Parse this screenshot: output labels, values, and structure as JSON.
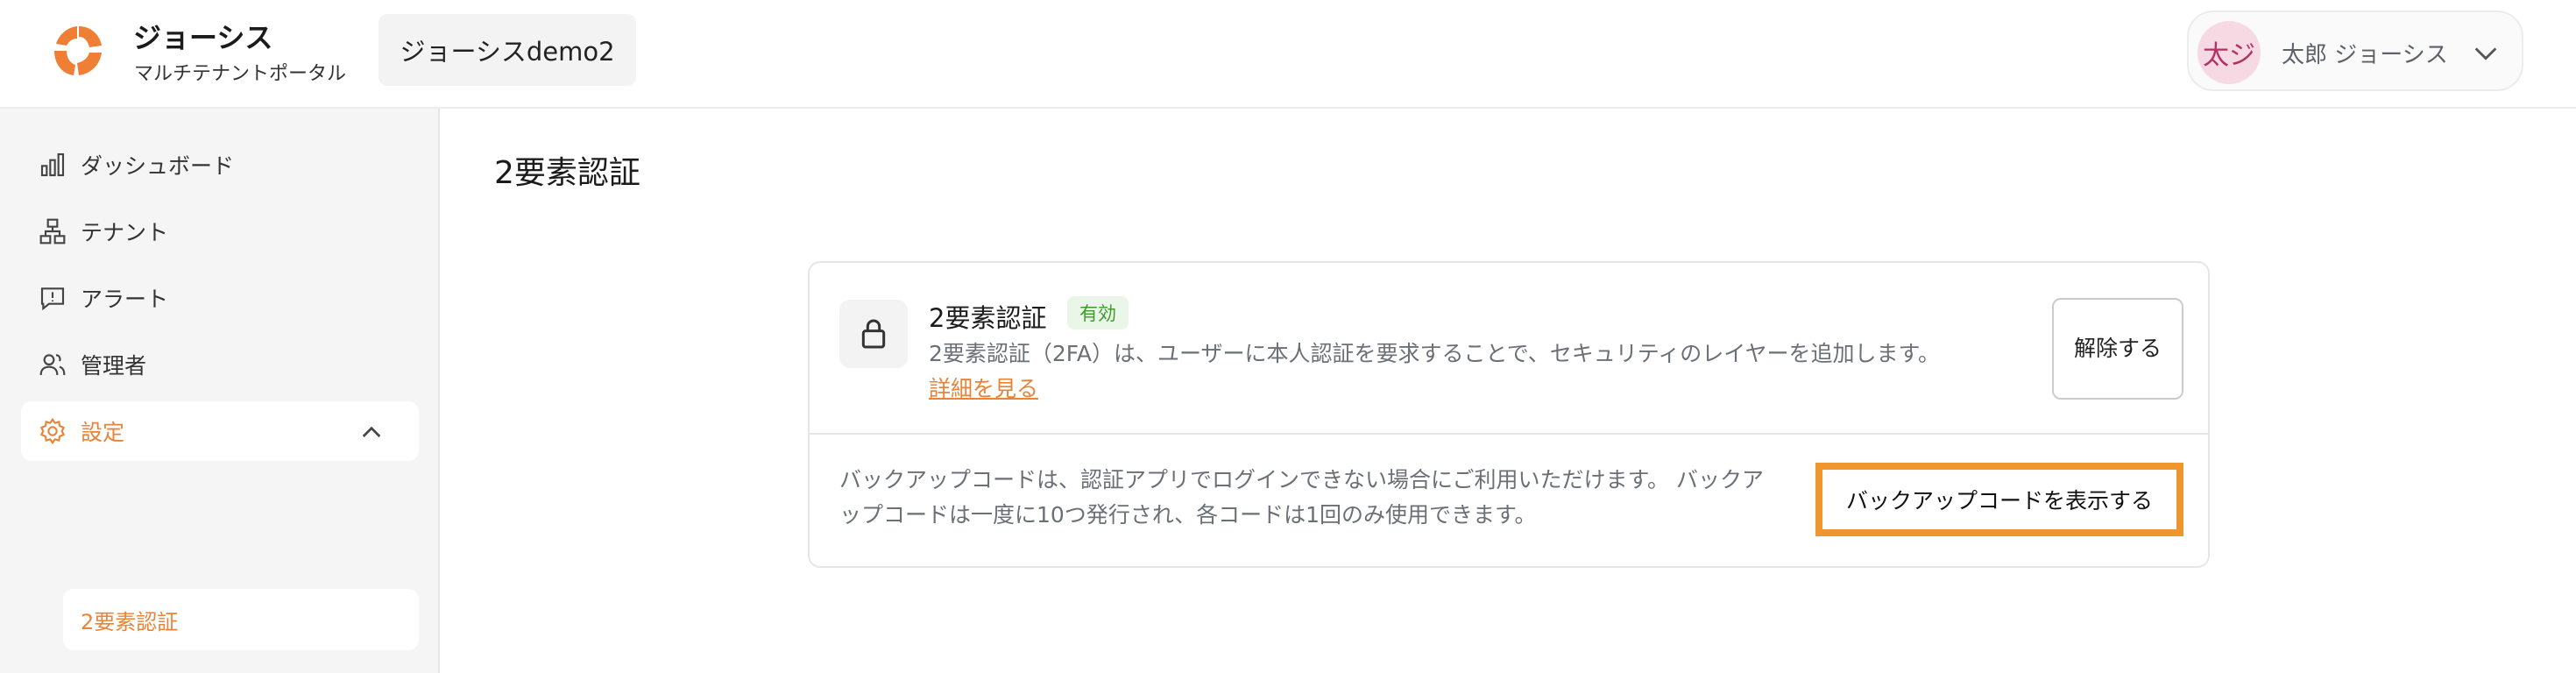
{
  "header": {
    "app_name": "ジョーシス",
    "app_subtitle": "マルチテナントポータル",
    "tenant_name": "ジョーシスdemo2",
    "user": {
      "avatar_initials": "太ジ",
      "name": "太郎 ジョーシス"
    }
  },
  "sidebar": {
    "items": [
      {
        "label": "ダッシュボード",
        "icon": "bar-chart-icon"
      },
      {
        "label": "テナント",
        "icon": "org-tree-icon"
      },
      {
        "label": "アラート",
        "icon": "alert-message-icon"
      },
      {
        "label": "管理者",
        "icon": "users-icon"
      },
      {
        "label": "設定",
        "icon": "gear-icon",
        "active": true
      }
    ],
    "sub_items": [
      {
        "label": "2要素認証",
        "active": true
      }
    ]
  },
  "main": {
    "page_title": "2要素認証",
    "twofa": {
      "title": "2要素認証",
      "status_badge": "有効",
      "description": "2要素認証（2FA）は、ユーザーに本人認証を要求することで、セキュリティのレイヤーを追加します。",
      "details_link": "詳細を見る",
      "disable_button": "解除する"
    },
    "backup": {
      "description": "バックアップコードは、認証アプリでログインできない場合にご利用いただけます。 バックアップコードは一度に10つ発行され、各コードは1回のみ使用できます。",
      "show_button": "バックアップコードを表示する"
    }
  },
  "colors": {
    "accent": "#e8843a",
    "highlight_border": "#f0962f",
    "badge_bg": "#eaf6e7",
    "badge_text": "#3f9a2d",
    "avatar_bg": "#f7d9e4"
  }
}
